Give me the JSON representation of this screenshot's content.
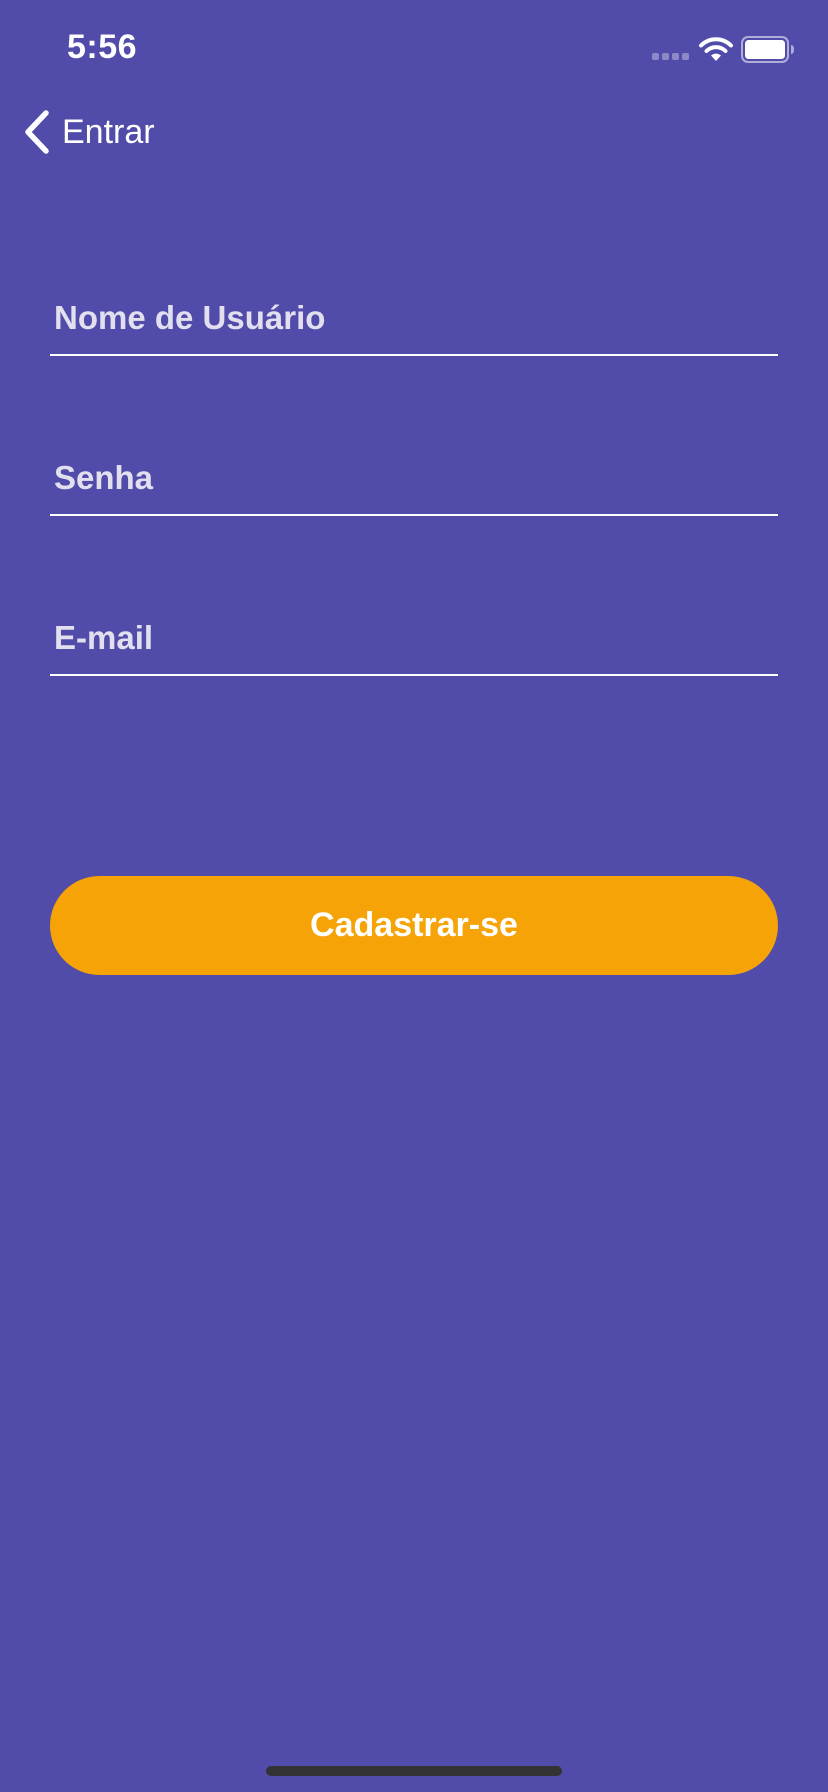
{
  "status_bar": {
    "time": "5:56",
    "icons": [
      "signal-icon",
      "wifi-icon",
      "battery-icon"
    ]
  },
  "nav": {
    "back_icon": "chevron-left-icon",
    "back_label": "Entrar"
  },
  "form": {
    "username": {
      "placeholder": "Nome de Usuário",
      "value": ""
    },
    "password": {
      "placeholder": "Senha",
      "value": ""
    },
    "email": {
      "placeholder": "E-mail",
      "value": ""
    }
  },
  "signup_button": {
    "label": "Cadastrar-se"
  },
  "colors": {
    "background": "#514BAA",
    "accent": "#F5A306",
    "text": "#FFFFFF"
  }
}
